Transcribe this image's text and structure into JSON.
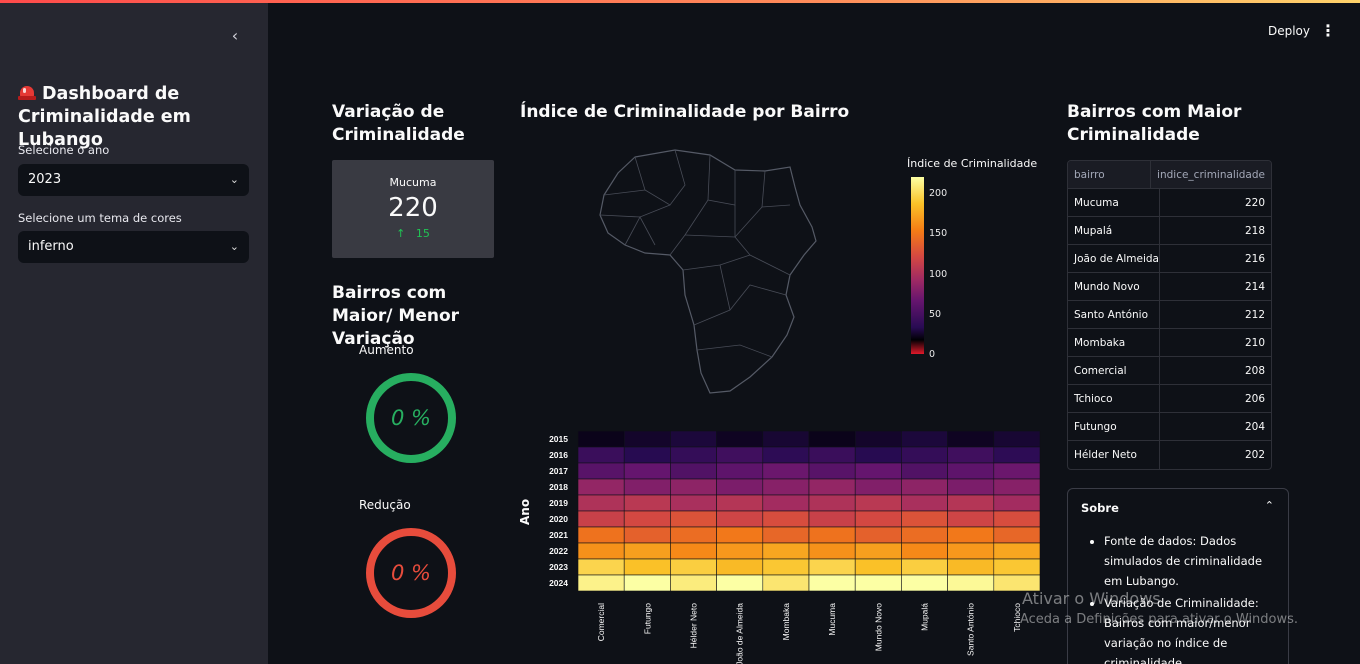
{
  "app": {
    "deploy_label": "Deploy",
    "menu_glyph": "⋮",
    "collapse_glyph": "‹"
  },
  "sidebar": {
    "title": "Dashboard de Criminalidade em Lubango",
    "title_icon": "siren-icon",
    "year_label": "Selecione o ano",
    "year_value": "2023",
    "theme_label": "Selecione um tema de cores",
    "theme_value": "inferno",
    "chevron": "⌄"
  },
  "variation": {
    "heading": "Variação de Criminalidade",
    "metric_label": "Mucuma",
    "metric_value": "220",
    "metric_delta": "15",
    "delta_arrow": "↑",
    "delta_color": "#21c354"
  },
  "minmax": {
    "heading": "Bairros com Maior/ Menor Variação",
    "increase_label": "Aumento",
    "increase_value": "0 %",
    "increase_color": "#27ae60",
    "decrease_label": "Redução",
    "decrease_value": "0 %",
    "decrease_color": "#e74c3c"
  },
  "map": {
    "heading": "Índice de Criminalidade por Bairro",
    "legend_title": "Índice de Criminalidade",
    "ticks": [
      "200",
      "150",
      "100",
      "50",
      "0"
    ]
  },
  "chart_data": {
    "type": "heatmap",
    "ylabel": "Ano",
    "x": [
      "Comercial",
      "Futungo",
      "Hélder Neto",
      "João de Almeida",
      "Mombaka",
      "Mucuma",
      "Mundo Novo",
      "Mupalá",
      "Santo António",
      "Tchioco"
    ],
    "y": [
      "2015",
      "2016",
      "2017",
      "2018",
      "2019",
      "2020",
      "2021",
      "2022",
      "2023",
      "2024"
    ],
    "colorscale": "inferno",
    "zrange": [
      0,
      220
    ]
  },
  "table": {
    "heading": "Bairros com Maior Criminalidade",
    "columns": [
      "bairro",
      "indice_criminalidade"
    ],
    "rows": [
      [
        "Mucuma",
        "220"
      ],
      [
        "Mupalá",
        "218"
      ],
      [
        "João de Almeida",
        "216"
      ],
      [
        "Mundo Novo",
        "214"
      ],
      [
        "Santo António",
        "212"
      ],
      [
        "Mombaka",
        "210"
      ],
      [
        "Comercial",
        "208"
      ],
      [
        "Tchioco",
        "206"
      ],
      [
        "Futungo",
        "204"
      ],
      [
        "Hélder Neto",
        "202"
      ]
    ]
  },
  "about": {
    "title": "Sobre",
    "chevron": "⌃",
    "bullets": [
      "Fonte de dados: Dados simulados de criminalidade em Lubango.",
      "Variação de Criminalidade: Bairros com maior/menor variação no índice de criminalidade."
    ]
  },
  "watermark": {
    "line1": "Ativar o Windows",
    "line2": "Aceda a Definições para ativar o Windows."
  }
}
